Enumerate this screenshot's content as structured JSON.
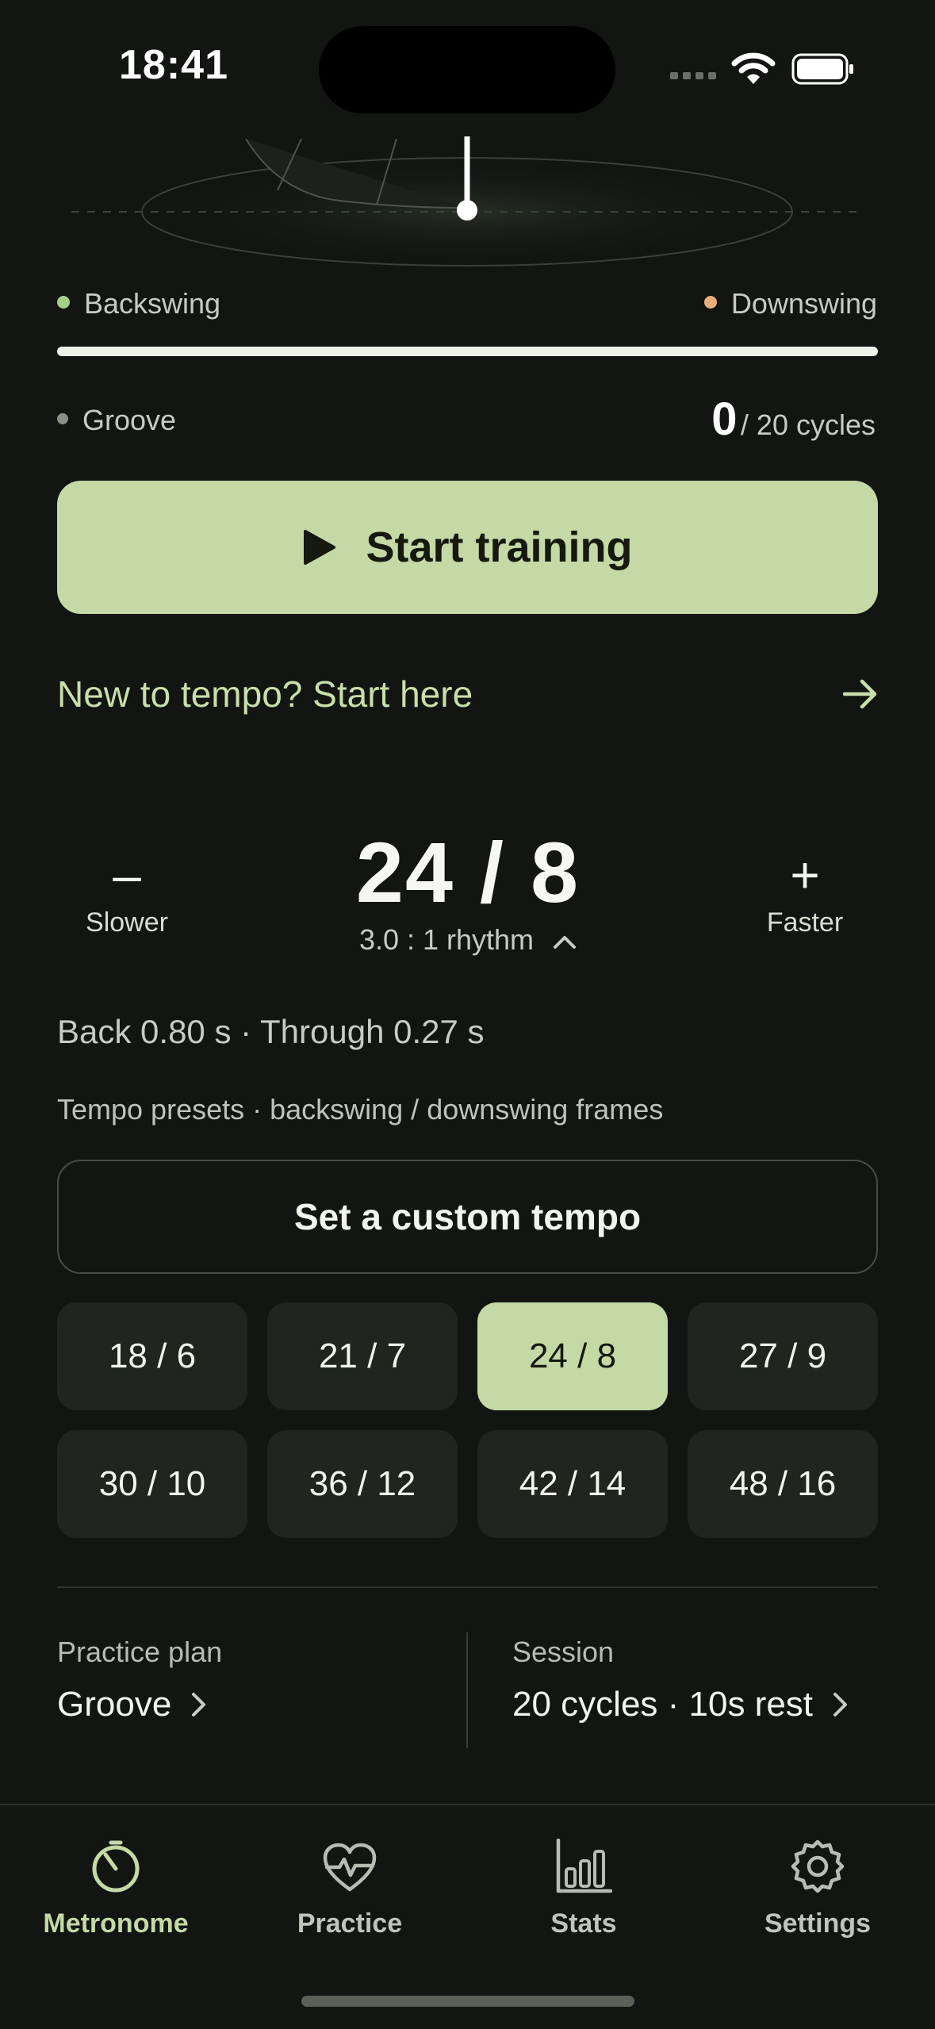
{
  "status": {
    "time": "18:41"
  },
  "legend": {
    "backswing": "Backswing",
    "downswing": "Downswing",
    "groove": "Groove"
  },
  "progress": {
    "count": "0",
    "total": "/ 20 cycles",
    "fraction": 0
  },
  "start_button": {
    "label": "Start training"
  },
  "intro_link": {
    "label": "New to tempo? Start here"
  },
  "tempo": {
    "slower_symbol": "–",
    "slower_label": "Slower",
    "faster_symbol": "+",
    "faster_label": "Faster",
    "value": "24 / 8",
    "rhythm": "3.0 : 1 rhythm"
  },
  "timing": "Back 0.80 s · Through 0.27 s",
  "presets": {
    "caption": "Tempo presets · backswing / downswing frames",
    "custom_label": "Set a custom tempo",
    "items": [
      "18 / 6",
      "21 / 7",
      "24 / 8",
      "27 / 9",
      "30 / 10",
      "36 / 12",
      "42 / 14",
      "48 / 16"
    ],
    "selected": "24 / 8"
  },
  "plan": {
    "caption": "Practice plan",
    "value": "Groove"
  },
  "session": {
    "caption": "Session",
    "value": "20 cycles · 10s rest"
  },
  "tabs": [
    {
      "label": "Metronome",
      "icon": "metronome-icon"
    },
    {
      "label": "Practice",
      "icon": "heart-pulse-icon"
    },
    {
      "label": "Stats",
      "icon": "bar-chart-icon"
    },
    {
      "label": "Settings",
      "icon": "gear-icon"
    }
  ],
  "colors": {
    "accent": "#c4d9a6",
    "backswing": "#a6cf87",
    "downswing": "#e7b07a",
    "background": "#121512"
  }
}
